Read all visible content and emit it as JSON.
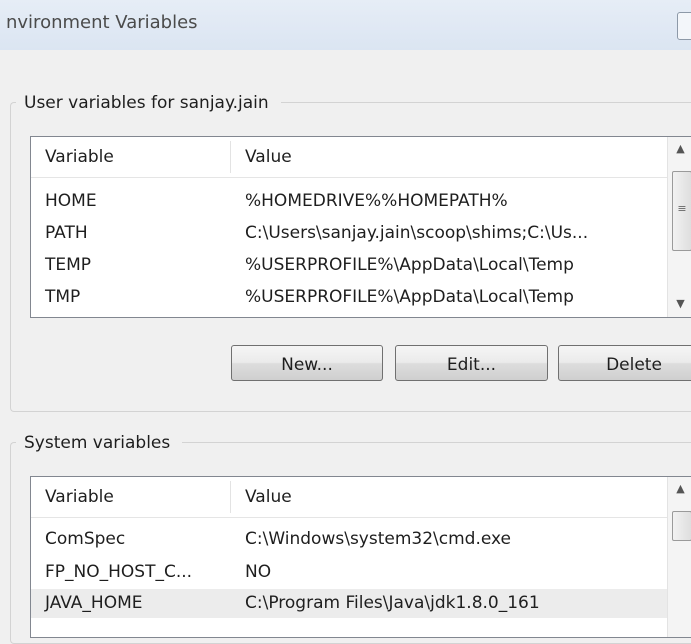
{
  "window": {
    "title": "nvironment Variables"
  },
  "user_section": {
    "legend": "User variables for sanjay.jain",
    "headers": [
      "Variable",
      "Value"
    ],
    "rows": [
      {
        "variable": "HOME",
        "value": "%HOMEDRIVE%%HOMEPATH%"
      },
      {
        "variable": "PATH",
        "value": "C:\\Users\\sanjay.jain\\scoop\\shims;C:\\Us..."
      },
      {
        "variable": "TEMP",
        "value": "%USERPROFILE%\\AppData\\Local\\Temp"
      },
      {
        "variable": "TMP",
        "value": "%USERPROFILE%\\AppData\\Local\\Temp"
      }
    ],
    "buttons": {
      "new": "New...",
      "edit": "Edit...",
      "delete": "Delete"
    }
  },
  "system_section": {
    "legend": "System variables",
    "headers": [
      "Variable",
      "Value"
    ],
    "rows": [
      {
        "variable": "ComSpec",
        "value": "C:\\Windows\\system32\\cmd.exe"
      },
      {
        "variable": "FP_NO_HOST_C...",
        "value": "NO"
      },
      {
        "variable": "JAVA_HOME",
        "value": "C:\\Program Files\\Java\\jdk1.8.0_161"
      }
    ]
  },
  "icons": {
    "scroll_up": "scroll-up-arrow",
    "scroll_down": "scroll-down-arrow",
    "grip": "scroll-grip"
  }
}
